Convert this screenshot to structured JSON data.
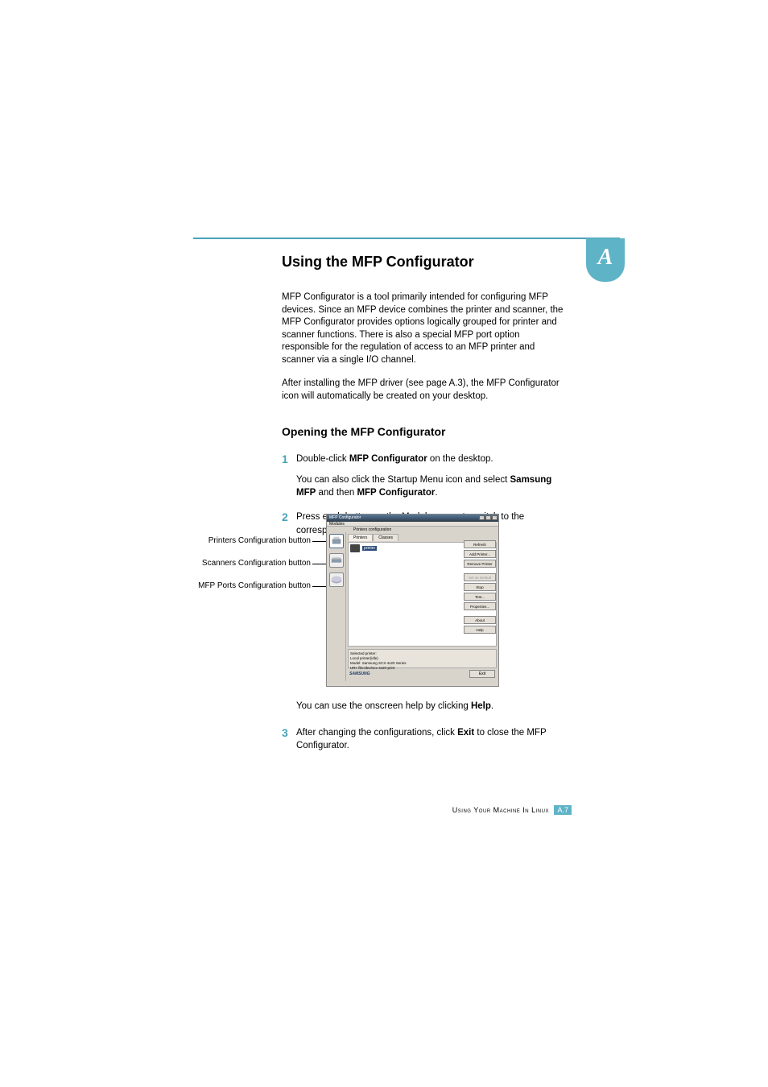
{
  "badge": "A",
  "heading": "Using the MFP Configurator",
  "intro1": "MFP Configurator is a tool primarily intended for configuring MFP devices. Since an MFP device combines the printer and scanner, the MFP Configurator provides options logically grouped for printer and scanner functions. There is also a special MFP port option responsible for the regulation of access to an MFP printer and scanner via a single I/O channel.",
  "intro2": "After installing the MFP driver (see page A.3), the MFP Configurator icon will automatically be created on your desktop.",
  "subheading": "Opening the MFP Configurator",
  "step1_num": "1",
  "step1_a": "Double-click ",
  "step1_b": "MFP Configurator",
  "step1_c": " on the desktop.",
  "step1_sub_a": "You can also click the Startup Menu icon and select ",
  "step1_sub_b": "Samsung MFP",
  "step1_sub_c": " and then ",
  "step1_sub_d": "MFP Configurator",
  "step1_sub_e": ".",
  "step2_num": "2",
  "step2_text": "Press each button on the Modules pane to switch to the corresponding configuration window.",
  "callouts": {
    "printers": "Printers Configuration button",
    "scanners": "Scanners Configuration button",
    "ports": "MFP Ports Configuration button"
  },
  "app": {
    "title": "MFP Configurator",
    "menu": "Modules",
    "section": "Printers configuration",
    "tab1": "Printers",
    "tab2": "Classes",
    "printer_name": "printer",
    "selected_header": "Selected printer:",
    "selected_line1": "Local printer(idle)",
    "selected_line2": "Model: Samsung SCX-4x20 Series",
    "selected_line3": "URI: file:/dev/scx-4x20-print",
    "buttons": {
      "refresh": "Refresh",
      "add": "Add Printer...",
      "remove": "Remove Printer",
      "default": "Set as Default",
      "stop": "Stop",
      "test": "Test...",
      "props": "Properties...",
      "about": "About",
      "help": "Help"
    },
    "logo": "SAMSUNG",
    "exit": "Exit"
  },
  "after1_a": "You can use the onscreen help by clicking ",
  "after1_b": "Help",
  "after1_c": ".",
  "step3_num": "3",
  "step3_a": "After changing the configurations, click ",
  "step3_b": "Exit",
  "step3_c": " to close the MFP Configurator.",
  "footer_label": "Using Your Machine In Linux",
  "page_num": "A.7"
}
